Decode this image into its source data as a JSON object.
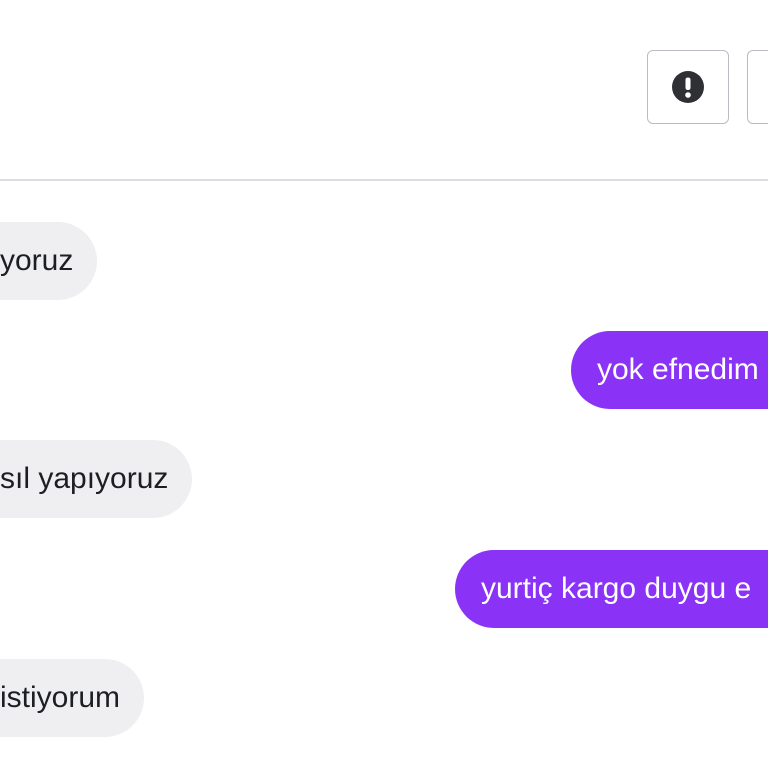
{
  "header": {
    "report_button": {
      "icon": "exclamation-circle-icon"
    },
    "more_button": {
      "icon": "partially-visible-button"
    }
  },
  "messages": [
    {
      "side": "incoming",
      "text": "yoruz"
    },
    {
      "side": "outgoing",
      "text": "yok efnedim"
    },
    {
      "side": "incoming",
      "text": "sıl yapıyoruz"
    },
    {
      "side": "outgoing",
      "text": "yurtiç kargo duygu e"
    },
    {
      "side": "incoming",
      "text": "istiyorum"
    }
  ],
  "colors": {
    "outgoing_bubble": "#8a33f7",
    "incoming_bubble": "#efeff1",
    "divider": "#dadde1",
    "button_border": "#b9bdc3"
  }
}
